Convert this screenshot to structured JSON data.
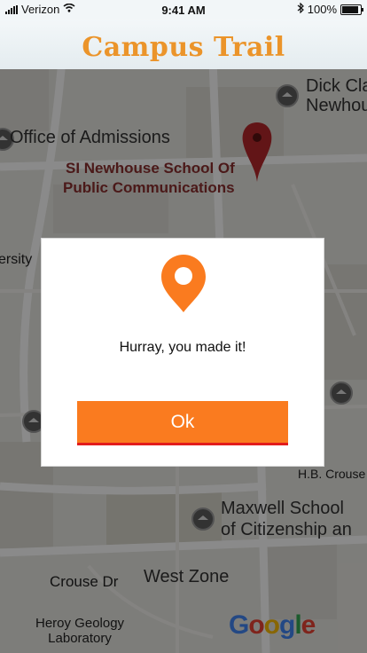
{
  "status_bar": {
    "carrier": "Verizon",
    "time": "9:41 AM",
    "battery": "100%"
  },
  "header": {
    "title": "Campus Trail"
  },
  "map": {
    "labels": {
      "dick_clark": "Dick Cla",
      "newhouse": "Newhou",
      "office": "Office of Admissions",
      "poi_line1": "SI Newhouse School Of",
      "poi_line2": "Public Communications",
      "university": "ersity",
      "hb_crouse": "H.B. Crouse",
      "maxwell1": "Maxwell School",
      "maxwell2": "of Citizenship an",
      "crouse_dr": "Crouse Dr",
      "west_zone": "West Zone",
      "heroy1": "Heroy Geology",
      "heroy2": "Laboratory"
    },
    "attribution": "Google"
  },
  "dialog": {
    "message": "Hurray, you made it!",
    "ok_label": "Ok",
    "accent_color": "#fa7b1f"
  }
}
